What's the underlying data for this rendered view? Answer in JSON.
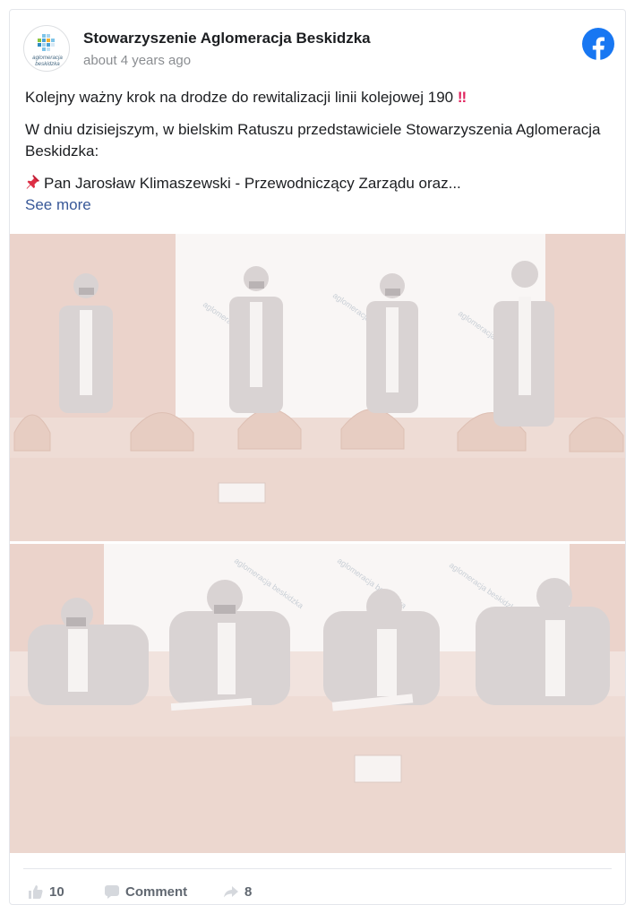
{
  "post": {
    "page_name": "Stowarzyszenie Aglomeracja Beskidzka",
    "timestamp": "about 4 years ago",
    "avatar_text_line1": "aglomeracja",
    "avatar_text_line2": "beskidzka",
    "paragraph1": "Kolejny ważny krok na drodze do rewitalizacji linii kolejowej 190",
    "paragraph1_emoji": "‼",
    "paragraph2": "W dniu dzisiejszym, w bielskim Ratuszu przedstawiciele Stowarzyszenia Aglomeracja Beskidzka:",
    "paragraph3": "Pan Jarosław Klimaszewski - Przewodniczący Zarządu oraz...",
    "see_more": "See more"
  },
  "photos": {
    "backdrop_text": "aglomeracja beskidzka"
  },
  "actions": {
    "likes_count": "10",
    "comment_label": "Comment",
    "shares_count": "8"
  },
  "colors": {
    "brand_blue": "#1877f2",
    "link": "#385898",
    "accent_red": "#e0245e"
  },
  "icons": {
    "facebook": "facebook-icon",
    "pin": "pushpin-icon",
    "like": "thumbs-up-icon",
    "comment": "comment-icon",
    "share": "share-icon"
  }
}
